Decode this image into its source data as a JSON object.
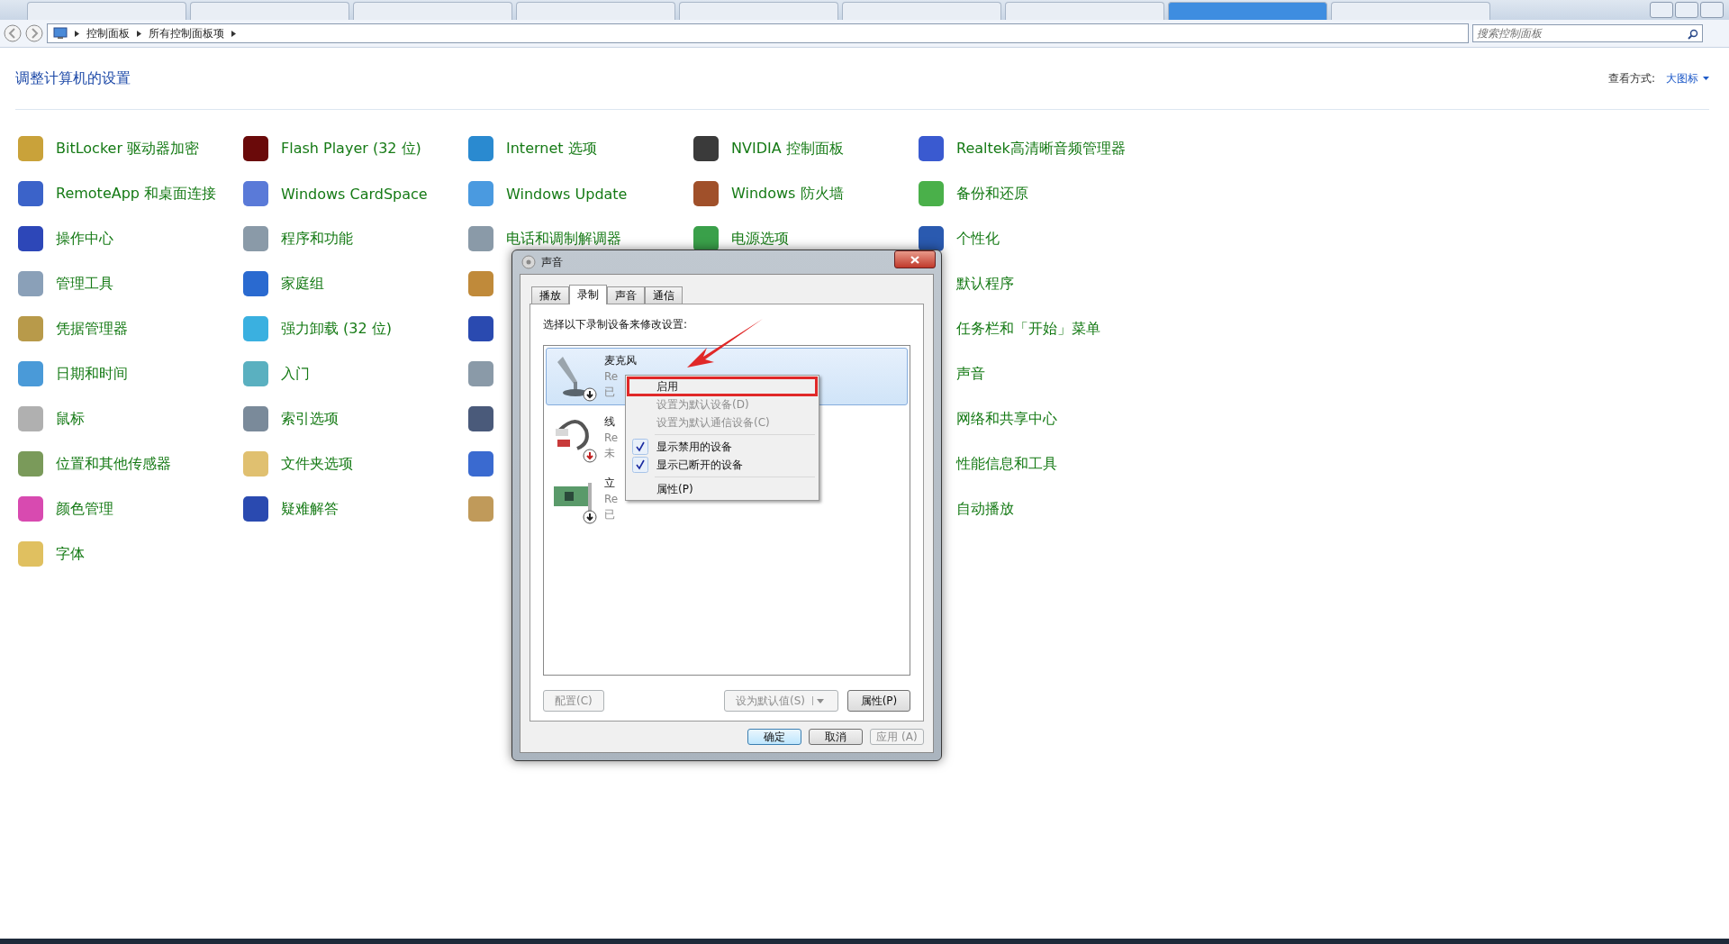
{
  "browser_tabs": [
    {
      "selected": false
    },
    {
      "selected": false
    },
    {
      "selected": false
    },
    {
      "selected": false
    },
    {
      "selected": false
    },
    {
      "selected": false
    },
    {
      "selected": false
    },
    {
      "selected": true
    },
    {
      "selected": false
    }
  ],
  "address_bar": {
    "breadcrumbs": [
      "控制面板",
      "所有控制面板项"
    ],
    "search": {
      "placeholder": "搜索控制面板"
    }
  },
  "header": {
    "title": "调整计算机的设置",
    "view_label": "查看方式:",
    "view_value": "大图标"
  },
  "columns": [
    {
      "items": [
        {
          "label": "BitLocker 驱动器加密",
          "color": "#c9a23a"
        },
        {
          "label": "RemoteApp 和桌面连接",
          "color": "#3b63c9"
        },
        {
          "label": "操作中心",
          "color": "#2d47b8"
        },
        {
          "label": "管理工具",
          "color": "#8aa0b8"
        },
        {
          "label": "凭据管理器",
          "color": "#b89a4a"
        },
        {
          "label": "日期和时间",
          "color": "#4a9ad8"
        },
        {
          "label": "鼠标",
          "color": "#b0b0b0"
        },
        {
          "label": "位置和其他传感器",
          "color": "#7a9a5a"
        },
        {
          "label": "颜色管理",
          "color": "#d84ab0"
        },
        {
          "label": "字体",
          "color": "#e0c060"
        }
      ]
    },
    {
      "items": [
        {
          "label": "Flash Player (32 位)",
          "color": "#6a0a0a"
        },
        {
          "label": "Windows CardSpace",
          "color": "#5a7ad8"
        },
        {
          "label": "程序和功能",
          "color": "#8a9aa8"
        },
        {
          "label": "家庭组",
          "color": "#2a6ad0"
        },
        {
          "label": "强力卸载 (32 位)",
          "color": "#3ab0e0"
        },
        {
          "label": "入门",
          "color": "#5ab0c0"
        },
        {
          "label": "索引选项",
          "color": "#7a8a9a"
        },
        {
          "label": "文件夹选项",
          "color": "#e0c070"
        },
        {
          "label": "疑难解答",
          "color": "#2a4ab0"
        }
      ]
    },
    {
      "items": [
        {
          "label": "Internet 选项",
          "color": "#2a8ad0"
        },
        {
          "label": "Windows Update",
          "color": "#4a9ae0"
        },
        {
          "label": "电话和调制解调器",
          "color": "#8a9aa8"
        },
        {
          "color": "#c08a3a"
        },
        {
          "color": "#2a4ab0"
        },
        {
          "color": "#8a9aa8"
        },
        {
          "color": "#4a5a7a"
        },
        {
          "color": "#3a6ad0"
        },
        {
          "color": "#c09a5a"
        }
      ]
    },
    {
      "items": [
        {
          "label": "NVIDIA 控制面板",
          "color": "#3a3a3a"
        },
        {
          "label": "Windows 防火墙",
          "color": "#a0502a"
        },
        {
          "label": "电源选项",
          "color": "#3aa04a"
        }
      ]
    },
    {
      "items": [
        {
          "label": "Realtek高清晰音频管理器",
          "color": "#3a5ad0"
        },
        {
          "label": "备份和还原",
          "color": "#4ab04a"
        },
        {
          "label": "个性化",
          "color": "#2a5ab0"
        },
        {
          "label": "默认程序"
        },
        {
          "label": "任务栏和「开始」菜单"
        },
        {
          "label": "声音"
        },
        {
          "label": "网络和共享中心"
        },
        {
          "label": "性能信息和工具"
        },
        {
          "label": "自动播放"
        }
      ]
    }
  ],
  "dialog": {
    "title": "声音",
    "tabs": [
      {
        "label": "播放",
        "selected": false
      },
      {
        "label": "录制",
        "selected": true
      },
      {
        "label": "声音",
        "selected": false
      },
      {
        "label": "通信",
        "selected": false
      }
    ],
    "instruction": "选择以下录制设备来修改设置:",
    "devices": [
      {
        "kind": "microphone",
        "name": "麦克风",
        "line_2": "Re",
        "line_3": "已",
        "selected": true
      },
      {
        "kind": "line-in",
        "name": "线",
        "line_2": "Re",
        "line_3": "未",
        "selected": false
      },
      {
        "kind": "card",
        "name": "立",
        "line_2": "Re",
        "line_3": "已",
        "selected": false
      }
    ],
    "context_menu": [
      {
        "label": "启用",
        "disabled": false,
        "checked": false,
        "highlighted": true
      },
      {
        "label": "设置为默认设备(D)",
        "disabled": true,
        "checked": false,
        "highlighted": false
      },
      {
        "label": "设置为默认通信设备(C)",
        "disabled": true,
        "checked": false,
        "highlighted": false,
        "separator_after": true
      },
      {
        "label": "显示禁用的设备",
        "disabled": false,
        "checked": true,
        "highlighted": false
      },
      {
        "label": "显示已断开的设备",
        "disabled": false,
        "checked": true,
        "highlighted": false,
        "separator_after": true
      },
      {
        "label": "属性(P)",
        "disabled": false,
        "checked": false,
        "highlighted": false
      }
    ],
    "pointer_arrow": true,
    "panel_buttons": {
      "configure": {
        "label": "配置(C)",
        "disabled": true
      },
      "set_default": {
        "label": "设为默认值(S)",
        "disabled": true
      },
      "properties": {
        "label": "属性(P)",
        "disabled": false
      }
    },
    "footer_buttons": [
      {
        "label": "确定",
        "disabled": false,
        "default": true
      },
      {
        "label": "取消",
        "disabled": false,
        "default": false
      },
      {
        "label": "应用 (A)",
        "disabled": true,
        "default": false
      }
    ]
  }
}
